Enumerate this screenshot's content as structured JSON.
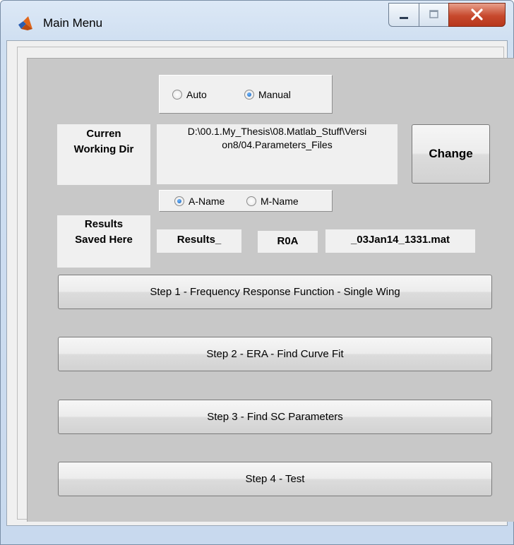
{
  "window": {
    "title": "Main Menu"
  },
  "mode": {
    "auto_label": "Auto",
    "manual_label": "Manual",
    "selected": "Manual"
  },
  "working_dir": {
    "label_line1": "Curren",
    "label_line2": "Working Dir",
    "path": "D:\\00.1.My_Thesis\\08.Matlab_Stuff\\Version8/04.Parameters_Files",
    "path_line1": "D:\\00.1.My_Thesis\\08.Matlab_Stuff\\Versi",
    "path_line2": "on8/04.Parameters_Files",
    "change_label": "Change"
  },
  "naming": {
    "a_label": "A-Name",
    "m_label": "M-Name",
    "selected": "A-Name"
  },
  "results": {
    "label_line1": "Results",
    "label_line2": "Saved Here",
    "prefix": "Results_",
    "id": "R0A",
    "suffix": "_03Jan14_1331.mat"
  },
  "steps": [
    {
      "label": "Step 1 - Frequency Response Function - Single Wing"
    },
    {
      "label": "Step 2 - ERA - Find Curve Fit"
    },
    {
      "label": "Step 3 - Find SC Parameters"
    },
    {
      "label": "Step 4 - Test"
    }
  ],
  "colors": {
    "panel_bg": "#c8c8c8",
    "box_bg": "#f0f0f0",
    "close_button": "#c7492d"
  }
}
